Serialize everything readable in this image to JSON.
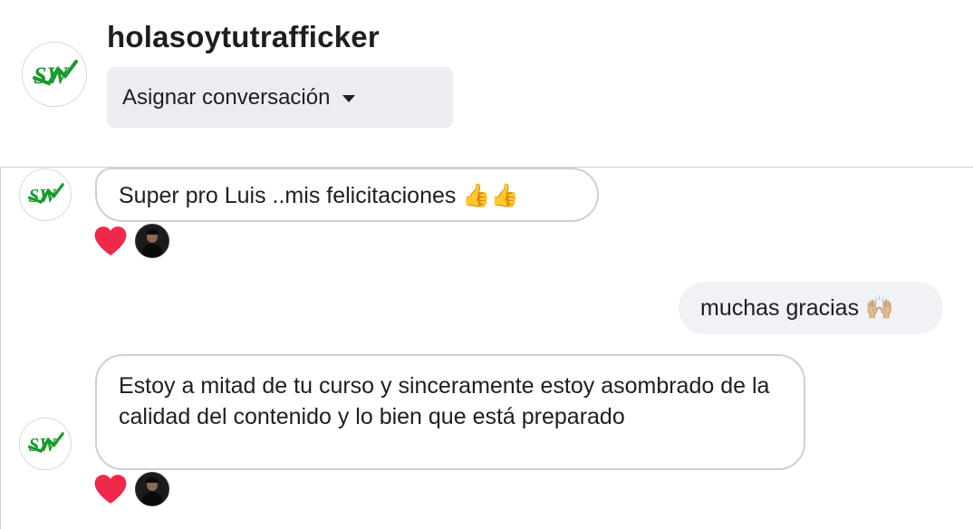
{
  "header": {
    "title": "holasoytutrafficker",
    "assign_label": "Asignar conversación",
    "avatar_logo_text": "SW"
  },
  "messages": [
    {
      "direction": "incoming",
      "text": "Super pro Luis ..mis felicitaciones 👍👍",
      "reactions": [
        "heart-icon"
      ]
    },
    {
      "direction": "outgoing",
      "text": "muchas gracias 🙌🏼"
    },
    {
      "direction": "incoming",
      "text": "Estoy a mitad de tu curso y sinceramente estoy asombrado de la calidad del contenido y lo bien que está preparado",
      "reactions": [
        "heart-icon"
      ]
    }
  ],
  "colors": {
    "heart": "#f02849",
    "logo_green": "#1a9a2c",
    "assign_bg": "#ebedf0",
    "outgoing_bubble": "#f0f2f5",
    "incoming_border": "#ccd0d5"
  }
}
